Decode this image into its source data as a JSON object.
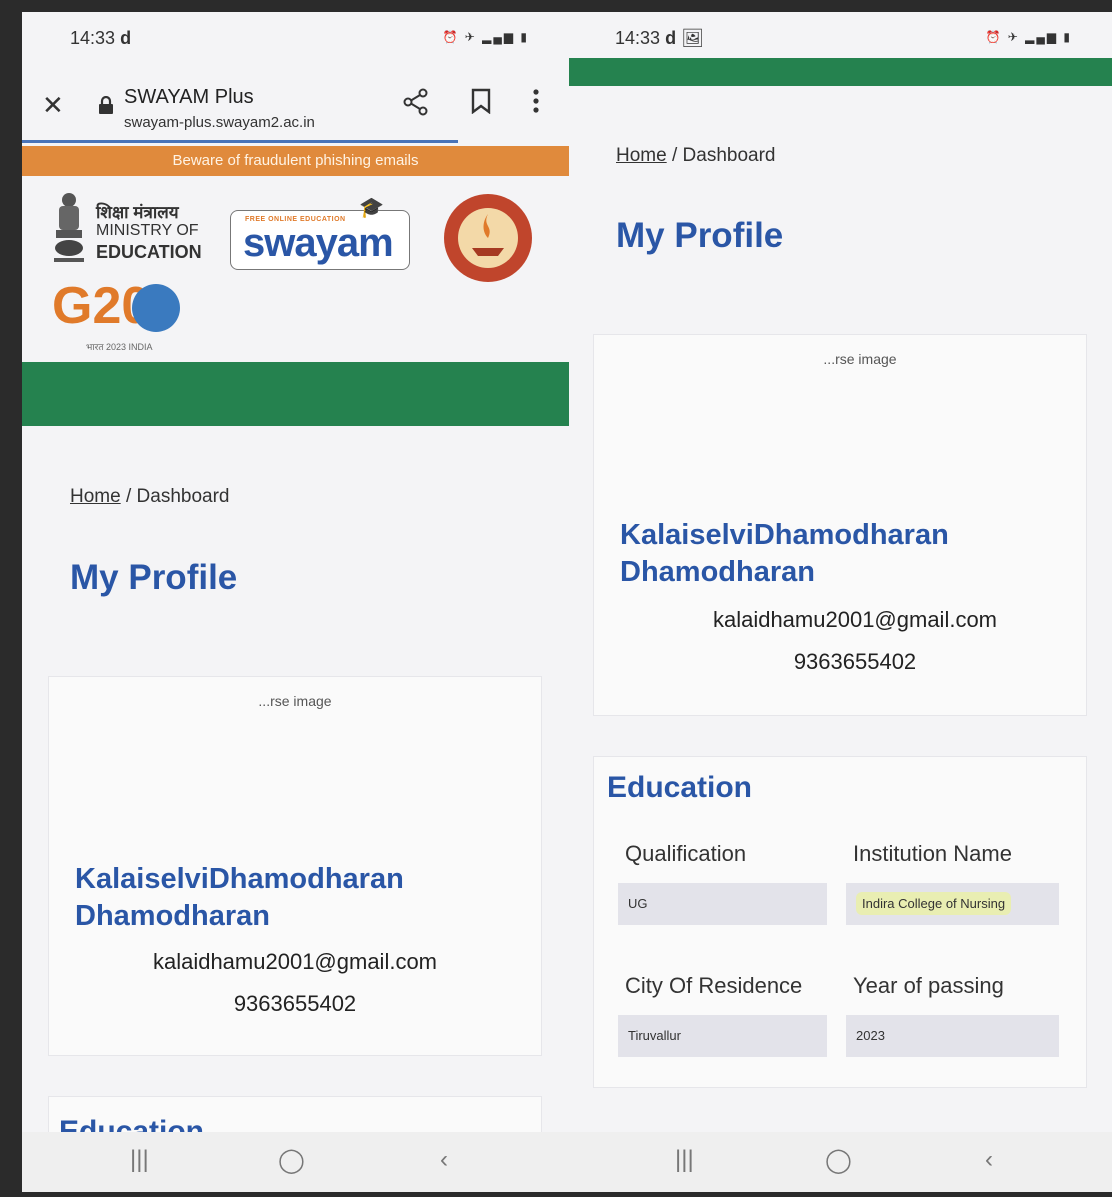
{
  "left": {
    "status": {
      "time": "14:33",
      "carrier": "d"
    },
    "browser": {
      "title": "SWAYAM Plus",
      "url": "swayam-plus.swayam2.ac.in"
    },
    "banner": "Beware of fraudulent phishing emails",
    "logos": {
      "moe_hindi": "शिक्षा मंत्रालय",
      "moe_line1": "MINISTRY OF",
      "moe_line2": "EDUCATION",
      "g20": "G20",
      "g20_sub": "भारत 2023 INDIA",
      "swayam_free": "FREE ONLINE EDUCATION",
      "swayam_word": "swayam"
    },
    "breadcrumb": {
      "home": "Home",
      "current": "/ Dashboard"
    },
    "heading": "My Profile",
    "profile": {
      "image_alt": "...rse image",
      "name_line1": "KalaiselviDhamodharan",
      "name_line2": "Dhamodharan",
      "email": "kalaidhamu2001@gmail.com",
      "phone": "9363655402"
    },
    "education_heading": "Education"
  },
  "right": {
    "status": {
      "time": "14:33",
      "carrier": "d"
    },
    "breadcrumb": {
      "home": "Home",
      "current": "/ Dashboard"
    },
    "heading": "My Profile",
    "profile": {
      "image_alt": "...rse image",
      "name_line1": "KalaiselviDhamodharan",
      "name_line2": "Dhamodharan",
      "email": "kalaidhamu2001@gmail.com",
      "phone": "9363655402"
    },
    "education": {
      "heading": "Education",
      "qualification_label": "Qualification",
      "qualification_value": "UG",
      "institution_label": "Institution Name",
      "institution_value": "Indira College of Nursing",
      "city_label": "City Of Residence",
      "city_value": "Tiruvallur",
      "year_label": "Year of passing",
      "year_value": "2023"
    }
  },
  "colors": {
    "brand_blue": "#2a56a6",
    "green_band": "#25824f",
    "banner_orange": "#e08a3c"
  },
  "icons": [
    "close-icon",
    "lock-icon",
    "share-icon",
    "bookmark-icon",
    "more-vert-icon",
    "recents-icon",
    "home-icon",
    "back-icon"
  ]
}
